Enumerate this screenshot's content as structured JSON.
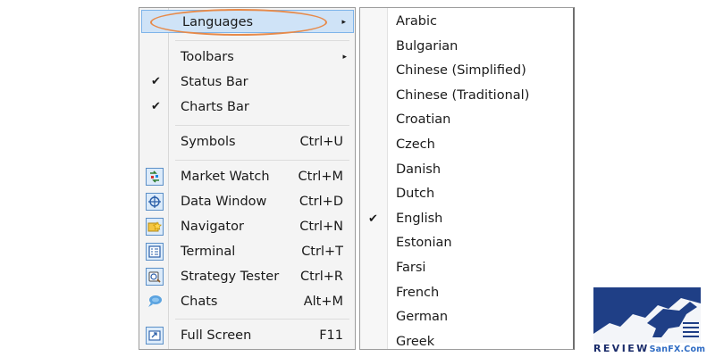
{
  "view_menu": {
    "items": [
      {
        "label": "Languages",
        "submenu": true,
        "highlighted": true
      },
      {
        "label": "Toolbars",
        "submenu": true
      },
      {
        "label": "Status Bar",
        "checked": true
      },
      {
        "label": "Charts Bar",
        "checked": true
      },
      {
        "label": "Symbols",
        "shortcut": "Ctrl+U"
      },
      {
        "label": "Market Watch",
        "shortcut": "Ctrl+M",
        "icon": "market-watch-icon"
      },
      {
        "label": "Data Window",
        "shortcut": "Ctrl+D",
        "icon": "data-window-icon"
      },
      {
        "label": "Navigator",
        "shortcut": "Ctrl+N",
        "icon": "navigator-icon"
      },
      {
        "label": "Terminal",
        "shortcut": "Ctrl+T",
        "icon": "terminal-icon"
      },
      {
        "label": "Strategy Tester",
        "shortcut": "Ctrl+R",
        "icon": "strategy-tester-icon"
      },
      {
        "label": "Chats",
        "shortcut": "Alt+M",
        "icon": "chats-icon"
      },
      {
        "label": "Full Screen",
        "shortcut": "F11",
        "icon": "full-screen-icon"
      }
    ],
    "check_glyph": "✔",
    "arrow_glyph": "▸"
  },
  "languages_submenu": {
    "items": [
      "Arabic",
      "Bulgarian",
      "Chinese (Simplified)",
      "Chinese (Traditional)",
      "Croatian",
      "Czech",
      "Danish",
      "Dutch",
      "English",
      "Estonian",
      "Farsi",
      "French",
      "German",
      "Greek"
    ],
    "selected": "English"
  },
  "annotation": {
    "color": "#e78a4a",
    "target": "Languages"
  },
  "logo": {
    "word1": "REVIEW",
    "word2": "SanFX.Com",
    "color_dark": "#1a2c6b",
    "color_light": "#2f6cc4"
  },
  "colors": {
    "highlight_bg": "#cfe3f7",
    "highlight_border": "#7eb4ea",
    "menu_bg": "#f4f4f4"
  }
}
